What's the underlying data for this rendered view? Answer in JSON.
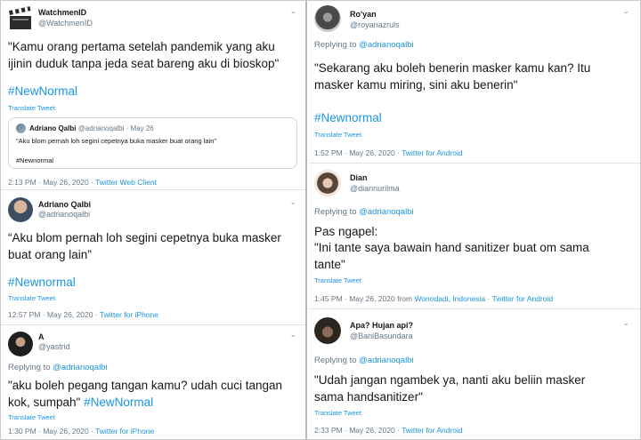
{
  "colors": {
    "link": "#1b95e0",
    "muted": "#657786",
    "text": "#14171a",
    "border": "#dfe3e7"
  },
  "left": {
    "t1": {
      "name": "WatchmenID",
      "handle": "@WatchmenID",
      "text": "\"Kamu orang pertama setelah pandemik yang aku ijinin duduk tanpa jeda seat bareng aku di bioskop\"",
      "hashtag": "#NewNormal",
      "translate": "Translate Tweet",
      "quote": {
        "name": "Adriano Qalbi",
        "meta": "@adrianoqalbi · May 26",
        "text": "\"Aku blom pernah loh segini cepetnya buka masker buat orang lain\"",
        "hashtag": "#Newnormal"
      },
      "time": "2:13 PM · May 26, 2020 · ",
      "source": "Twitter Web Client"
    },
    "t2": {
      "name": "Adriano Qalbi",
      "handle": "@adrianoqalbi",
      "text": "“Aku blom pernah loh segini cepetnya buka masker buat orang lain”",
      "hashtag": "#Newnormal",
      "translate": "Translate Tweet",
      "time": "12:57 PM · May 26, 2020 · ",
      "source": "Twitter for iPhone"
    },
    "t3": {
      "name": "A",
      "handle": "@yastrid",
      "reply_prefix": "Replying to ",
      "reply_to": "@adrianoqalbi",
      "text": "\"aku boleh pegang tangan kamu? udah cuci tangan kok, sumpah\" ",
      "hashtag": "#NewNormal",
      "translate": "Translate Tweet",
      "time": "1:30 PM · May 26, 2020 · ",
      "source": "Twitter for iPhone"
    }
  },
  "right": {
    "t1": {
      "name": "Ro'yan",
      "handle": "@royanazruls",
      "reply_prefix": "Replying to ",
      "reply_to": "@adrianoqalbi",
      "text": "\"Sekarang aku boleh benerin masker kamu kan? Itu masker kamu miring, sini aku benerin\"",
      "hashtag": "#Newnormal",
      "translate": "Translate Tweet",
      "time": "1:52 PM · May 26, 2020 · ",
      "source": "Twitter for Android"
    },
    "t2": {
      "name": "Dian",
      "handle": "@diannurilma",
      "reply_prefix": "Replying to ",
      "reply_to": "@adrianoqalbi",
      "line1": "Pas ngapel:",
      "text": "\"Ini tante saya bawain hand sanitizer buat om sama tante\"",
      "translate": "Translate Tweet",
      "time": "1:45 PM · May 26, 2020 from ",
      "location": "Wonodadi, Indonesia",
      "sep": " · ",
      "source": "Twitter for Android"
    },
    "t3": {
      "name": "Apa? Hujan api?",
      "handle": "@BaniBasundara",
      "reply_prefix": "Replying to ",
      "reply_to": "@adrianoqalbi",
      "text": "\"Udah jangan ngambek ya, nanti aku beliin masker sama handsanitizer\"",
      "translate": "Translate Tweet",
      "time": "2:33 PM · May 26, 2020 · ",
      "source": "Twitter for Android"
    }
  },
  "icons": {
    "chevron": "chevron-down-icon",
    "clapper": "clapperboard-icon"
  }
}
